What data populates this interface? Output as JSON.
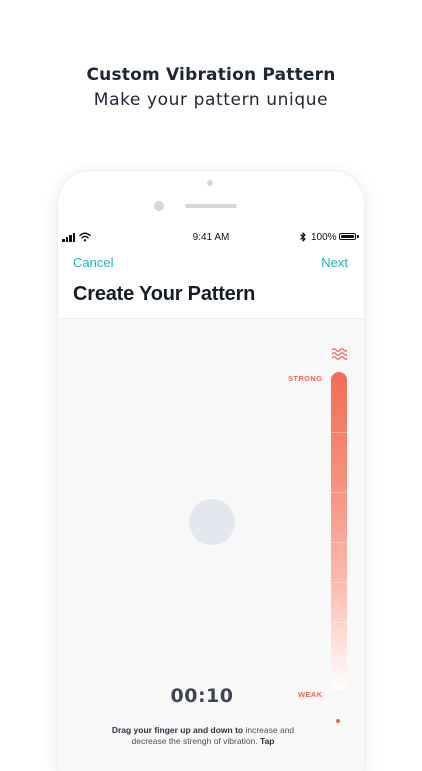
{
  "promo": {
    "title": "Custom Vibration Pattern",
    "subtitle": "Make your pattern unique"
  },
  "status_bar": {
    "time": "9:41 AM",
    "battery": "100%",
    "icons": [
      "signal-icon",
      "wifi-icon",
      "bluetooth-icon",
      "battery-icon"
    ]
  },
  "nav": {
    "cancel_label": "Cancel",
    "next_label": "Next"
  },
  "page": {
    "title": "Create Your Pattern"
  },
  "intensity": {
    "icon": "vibration-wave-icon",
    "strong_label": "STRONG",
    "weak_label": "WEAK"
  },
  "timer": "00:10",
  "instructions": {
    "bold_1": "Drag your finger up and down to",
    "text_1": " increase and decrease the strengh of vibration. ",
    "bold_2": "Tap"
  },
  "colors": {
    "accent": "#1db2c5",
    "intensity": "#f26d55",
    "title": "#151c27"
  }
}
